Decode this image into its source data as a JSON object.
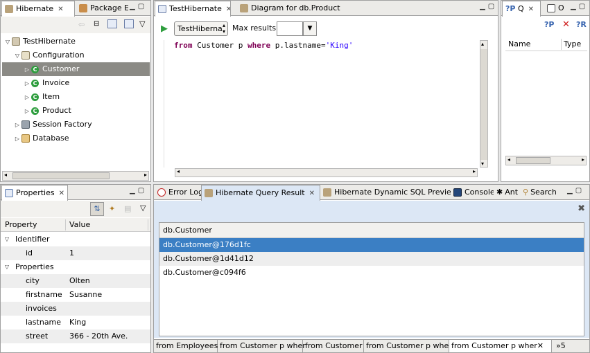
{
  "hibernate_view": {
    "tabs": [
      {
        "label": "Hibernate"
      },
      {
        "label": "Package E"
      }
    ],
    "tree": [
      {
        "label": "TestHibernate",
        "level": 0,
        "expanded": true
      },
      {
        "label": "Configuration",
        "level": 1,
        "expanded": true
      },
      {
        "label": "Customer",
        "level": 2,
        "selected": true
      },
      {
        "label": "Invoice",
        "level": 2
      },
      {
        "label": "Item",
        "level": 2
      },
      {
        "label": "Product",
        "level": 2
      },
      {
        "label": "Session Factory",
        "level": 1
      },
      {
        "label": "Database",
        "level": 1
      }
    ]
  },
  "editor": {
    "tabs": [
      {
        "label": "TestHibernate"
      },
      {
        "label": "Diagram for db.Product"
      }
    ],
    "config_select": "TestHiberna",
    "max_results_label": "Max results:",
    "max_results_value": "",
    "query": {
      "kw1": "from",
      "t1": " Customer p ",
      "kw2": "where",
      "t2": " p.lastname=",
      "str": "'King'"
    }
  },
  "query_params_view": {
    "tabs": [
      {
        "label": "Q"
      },
      {
        "label": "O"
      }
    ],
    "columns": [
      "Name",
      "Type"
    ]
  },
  "properties_view": {
    "tab": "Properties",
    "columns": [
      "Property",
      "Value"
    ],
    "rows": [
      {
        "name": "Identifier",
        "value": "",
        "group": true
      },
      {
        "name": "id",
        "value": "1"
      },
      {
        "name": "Properties",
        "value": "",
        "group": true
      },
      {
        "name": "city",
        "value": "Olten"
      },
      {
        "name": "firstname",
        "value": "Susanne"
      },
      {
        "name": "invoices",
        "value": ""
      },
      {
        "name": "lastname",
        "value": "King"
      },
      {
        "name": "street",
        "value": "366 - 20th Ave."
      }
    ]
  },
  "results_view": {
    "tabs": [
      {
        "label": "Error Log"
      },
      {
        "label": "Hibernate Query Result"
      },
      {
        "label": "Hibernate Dynamic SQL Preview"
      },
      {
        "label": "Console"
      },
      {
        "label": "Ant"
      },
      {
        "label": "Search"
      }
    ],
    "column": "db.Customer",
    "rows": [
      "db.Customer@176d1fc",
      "db.Customer@1d41d12",
      "db.Customer@c094f6"
    ],
    "query_tabs": [
      "from Employees",
      "from Customer p wher",
      "from Customer",
      "from Customer p wher",
      "from Customer p wher"
    ],
    "overflow": "»5"
  }
}
